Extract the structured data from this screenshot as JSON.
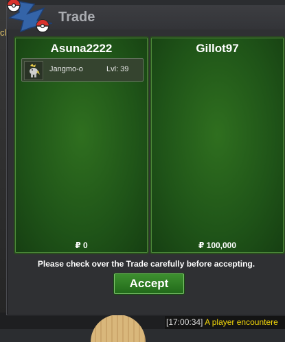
{
  "background": {
    "left_text": "cl",
    "chat": {
      "time": "[17:00:34]",
      "message": "A player encountere"
    }
  },
  "window": {
    "title": "Trade"
  },
  "left_panel": {
    "player": "Asuna2222",
    "items": [
      {
        "name": "Jangmo-o",
        "level": "Lvl: 39",
        "icon": "jangmo-o-sprite"
      }
    ],
    "money": "₽ 0"
  },
  "right_panel": {
    "player": "Gillot97",
    "items": [],
    "money": "₽ 100,000"
  },
  "footer": {
    "warning": "Please check over the Trade carefully before accepting.",
    "accept_label": "Accept"
  },
  "colors": {
    "panel_green": "#1f5418",
    "accent_green": "#3d8f2f",
    "chat_yellow": "#f2d60a"
  }
}
